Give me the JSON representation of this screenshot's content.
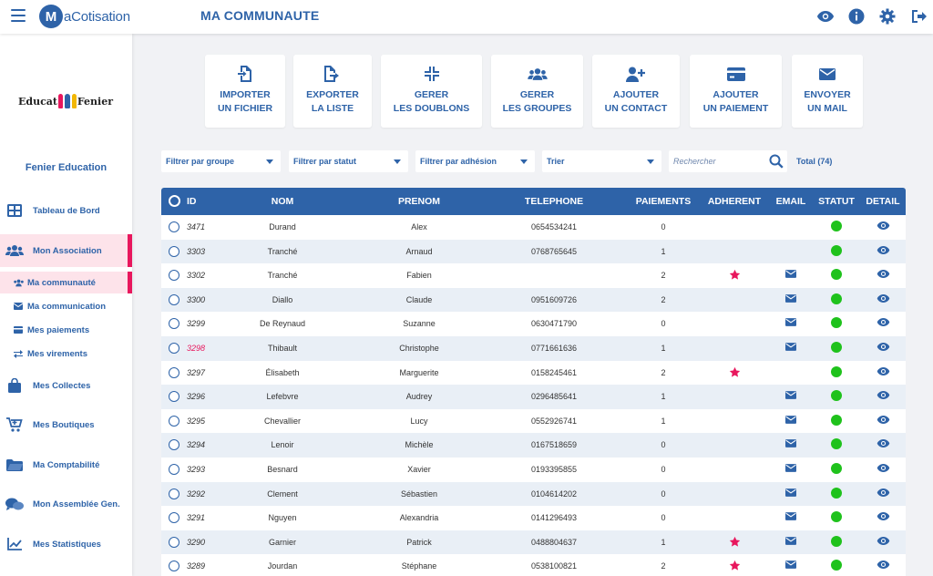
{
  "app": {
    "logo_letter": "M",
    "logo_text": "aCotisation",
    "page_title": "MA COMMUNAUTE"
  },
  "colors": {
    "primary": "#2e63a8",
    "accent": "#e8175d",
    "status_ok": "#1fc21c",
    "row_alt": "#e9eff6"
  },
  "top_icons": [
    "eye-icon",
    "info-icon",
    "gear-icon",
    "logout-icon"
  ],
  "sidebar": {
    "org_logo_text_left": "Educat",
    "org_logo_text_right": "Fenier",
    "org_name": "Fenier Education",
    "items": [
      {
        "label": "Tableau de Bord",
        "icon": "dashboard-icon"
      },
      {
        "label": "Mon Association",
        "icon": "users-icon"
      },
      {
        "label": "Ma communauté",
        "icon": "users-small-icon"
      },
      {
        "label": "Ma communication",
        "icon": "envelope-icon"
      },
      {
        "label": "Mes paiements",
        "icon": "card-icon"
      },
      {
        "label": "Mes virements",
        "icon": "transfer-icon"
      },
      {
        "label": "Mes Collectes",
        "icon": "bag-icon"
      },
      {
        "label": "Mes Boutiques",
        "icon": "cart-icon"
      },
      {
        "label": "Ma Comptabilité",
        "icon": "folder-icon"
      },
      {
        "label": "Mon Assemblée Gen.",
        "icon": "chat-icon"
      },
      {
        "label": "Mes Statistiques",
        "icon": "chart-icon"
      }
    ]
  },
  "actions": [
    {
      "line1": "IMPORTER",
      "line2": "UN FICHIER",
      "icon": "file-import-icon"
    },
    {
      "line1": "EXPORTER",
      "line2": "LA LISTE",
      "icon": "file-export-icon"
    },
    {
      "line1": "GERER",
      "line2": "LES DOUBLONS",
      "icon": "compress-icon"
    },
    {
      "line1": "GERER",
      "line2": "LES GROUPES",
      "icon": "group-icon"
    },
    {
      "line1": "AJOUTER",
      "line2": "UN CONTACT",
      "icon": "user-plus-icon"
    },
    {
      "line1": "AJOUTER",
      "line2": "UN PAIEMENT",
      "icon": "credit-card-icon"
    },
    {
      "line1": "ENVOYER",
      "line2": "UN MAIL",
      "icon": "mail-icon"
    }
  ],
  "filters": {
    "group": "Filtrer par groupe",
    "status": "Filtrer par statut",
    "membership": "Filtrer par adhésion",
    "sort": "Trier",
    "search_placeholder": "Rechercher",
    "total": "Total (74)"
  },
  "table": {
    "headers": [
      "ID",
      "NOM",
      "PRENOM",
      "TELEPHONE",
      "PAIEMENTS",
      "ADHERENT",
      "EMAIL",
      "STATUT",
      "DETAIL"
    ],
    "rows": [
      {
        "id": "3471",
        "nom": "Durand",
        "prenom": "Alex",
        "tel": "0654534241",
        "paiements": "0",
        "adherent": false,
        "email": false,
        "highlight": false
      },
      {
        "id": "3303",
        "nom": "Tranché",
        "prenom": "Arnaud",
        "tel": "0768765645",
        "paiements": "1",
        "adherent": false,
        "email": false,
        "highlight": false
      },
      {
        "id": "3302",
        "nom": "Tranché",
        "prenom": "Fabien",
        "tel": "",
        "paiements": "2",
        "adherent": true,
        "email": true,
        "highlight": false
      },
      {
        "id": "3300",
        "nom": "Diallo",
        "prenom": "Claude",
        "tel": "0951609726",
        "paiements": "2",
        "adherent": false,
        "email": true,
        "highlight": false
      },
      {
        "id": "3299",
        "nom": "De Reynaud",
        "prenom": "Suzanne",
        "tel": "0630471790",
        "paiements": "0",
        "adherent": false,
        "email": true,
        "highlight": false
      },
      {
        "id": "3298",
        "nom": "Thibault",
        "prenom": "Christophe",
        "tel": "0771661636",
        "paiements": "1",
        "adherent": false,
        "email": true,
        "highlight": true
      },
      {
        "id": "3297",
        "nom": "Élisabeth",
        "prenom": "Marguerite",
        "tel": "0158245461",
        "paiements": "2",
        "adherent": true,
        "email": false,
        "highlight": false
      },
      {
        "id": "3296",
        "nom": "Lefebvre",
        "prenom": "Audrey",
        "tel": "0296485641",
        "paiements": "1",
        "adherent": false,
        "email": true,
        "highlight": false
      },
      {
        "id": "3295",
        "nom": "Chevallier",
        "prenom": "Lucy",
        "tel": "0552926741",
        "paiements": "1",
        "adherent": false,
        "email": true,
        "highlight": false
      },
      {
        "id": "3294",
        "nom": "Lenoir",
        "prenom": "Michèle",
        "tel": "0167518659",
        "paiements": "0",
        "adherent": false,
        "email": true,
        "highlight": false
      },
      {
        "id": "3293",
        "nom": "Besnard",
        "prenom": "Xavier",
        "tel": "0193395855",
        "paiements": "0",
        "adherent": false,
        "email": true,
        "highlight": false
      },
      {
        "id": "3292",
        "nom": "Clement",
        "prenom": "Sébastien",
        "tel": "0104614202",
        "paiements": "0",
        "adherent": false,
        "email": true,
        "highlight": false
      },
      {
        "id": "3291",
        "nom": "Nguyen",
        "prenom": "Alexandria",
        "tel": "0141296493",
        "paiements": "0",
        "adherent": false,
        "email": true,
        "highlight": false
      },
      {
        "id": "3290",
        "nom": "Garnier",
        "prenom": "Patrick",
        "tel": "0488804637",
        "paiements": "1",
        "adherent": true,
        "email": true,
        "highlight": false
      },
      {
        "id": "3289",
        "nom": "Jourdan",
        "prenom": "Stéphane",
        "tel": "0538100821",
        "paiements": "2",
        "adherent": true,
        "email": true,
        "highlight": false
      }
    ]
  }
}
